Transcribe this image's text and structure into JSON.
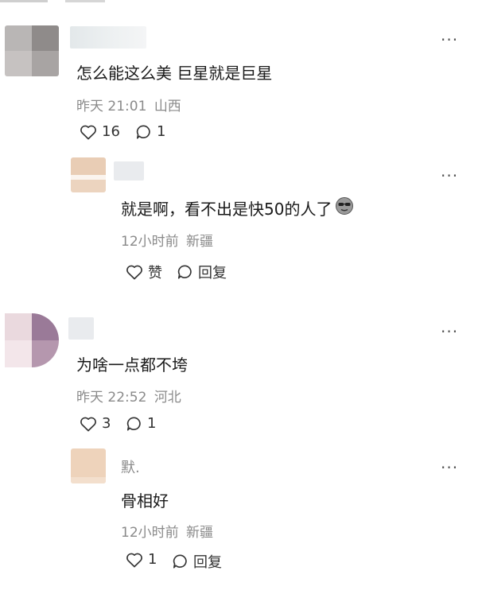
{
  "comments": [
    {
      "text": "怎么能这么美 巨星就是巨星",
      "time": "昨天 21:01",
      "location": "山西",
      "likes": "16",
      "replies_count": "1",
      "reply": {
        "author": "",
        "text": "就是啊，看不出是快50的人了",
        "time": "12小时前",
        "location": "新疆",
        "like_label": "赞",
        "reply_label": "回复"
      }
    },
    {
      "text": "为啥一点都不垮",
      "time": "昨天 22:52",
      "location": "河北",
      "likes": "3",
      "replies_count": "1",
      "reply": {
        "author": "默.",
        "text": "骨相好",
        "time": "12小时前",
        "location": "新疆",
        "likes": "1",
        "reply_label": "回复"
      }
    }
  ],
  "icons": {
    "more": "more-dots-icon",
    "like": "heart-outline-icon",
    "comment": "comment-bubble-icon",
    "emoji": "cool-face-emoji-icon"
  },
  "colors": {
    "meta": "#8a8a8a",
    "text": "#1a1a1a",
    "placeholder": "#e9ebee"
  }
}
